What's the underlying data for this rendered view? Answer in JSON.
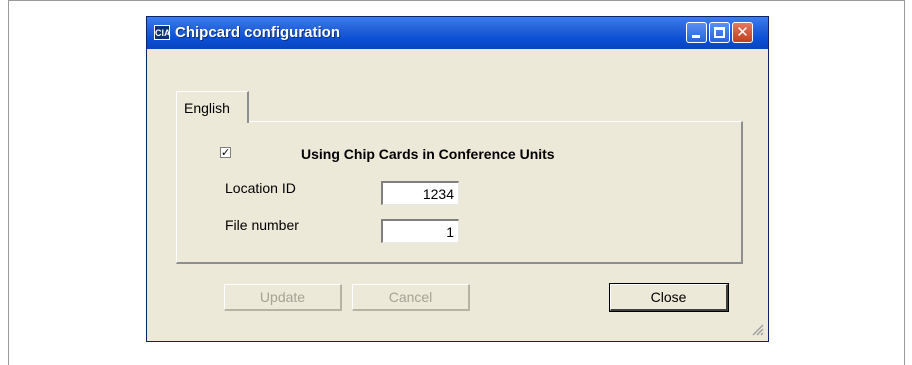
{
  "window": {
    "title": "Chipcard configuration",
    "app_icon_text": "CIA",
    "controls": [
      "minimize-icon",
      "maximize-icon",
      "close-icon"
    ]
  },
  "tabs": [
    {
      "label": "English",
      "selected": true
    }
  ],
  "form": {
    "use_chip_cards": {
      "label": "Using Chip Cards in Conference Units",
      "checked": true,
      "mark": "✓"
    },
    "location_id": {
      "label": "Location ID",
      "value": "1234"
    },
    "file_number": {
      "label": "File number",
      "value": "1"
    }
  },
  "buttons": {
    "update": {
      "label": "Update",
      "enabled": false
    },
    "cancel": {
      "label": "Cancel",
      "enabled": false
    },
    "close": {
      "label": "Close",
      "enabled": true
    }
  },
  "colors": {
    "titlebar": "#0b4fd4",
    "dialog_bg": "#ece9d8",
    "close_button": "#c0401e"
  }
}
